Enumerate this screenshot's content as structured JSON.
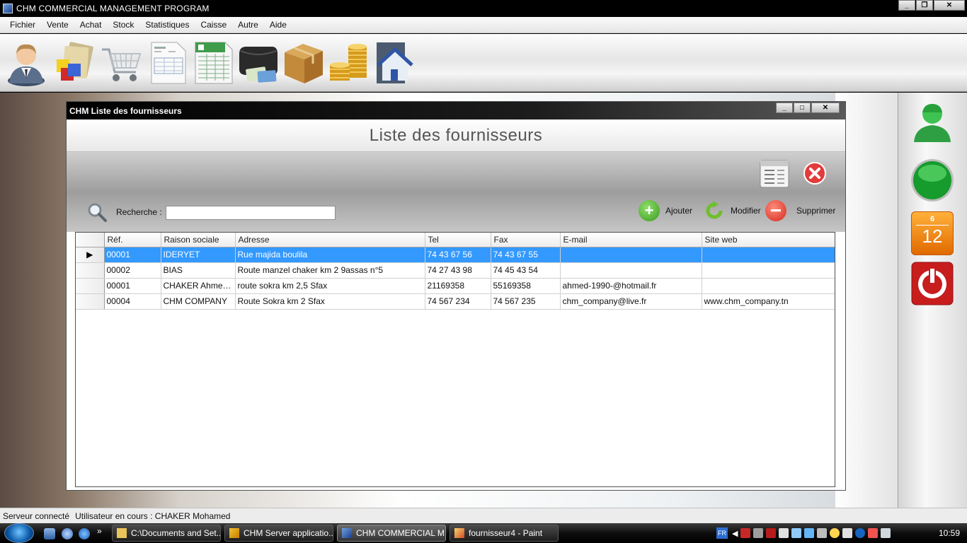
{
  "app": {
    "title": "CHM COMMERCIAL MANAGEMENT PROGRAM"
  },
  "menu": [
    "Fichier",
    "Vente",
    "Achat",
    "Stock",
    "Statistiques",
    "Caisse",
    "Autre",
    "Aide"
  ],
  "toolbar_icons": [
    "user-icon",
    "products-icon",
    "cart-icon",
    "invoice-icon",
    "spreadsheet-icon",
    "wallet-icon",
    "box-icon",
    "coins-icon",
    "home-icon"
  ],
  "side_panel": {
    "calendar_month": "6",
    "calendar_day": "12",
    "icons": [
      "online-user-icon",
      "status-globe-icon",
      "calendar-icon",
      "power-icon"
    ]
  },
  "child_window": {
    "title": "CHM Liste des fournisseurs",
    "heading": "Liste des fournisseurs",
    "search_label": "Recherche :",
    "search_value": "",
    "actions": {
      "add": "Ajouter",
      "modify": "Modifier",
      "delete": "Supprimer"
    }
  },
  "grid": {
    "columns": [
      "Réf.",
      "Raison sociale",
      "Adresse",
      "Tel",
      "Fax",
      "E-mail",
      "Site web"
    ],
    "rows": [
      {
        "ref": "00001",
        "raison": "IDERYET",
        "adresse": "Rue majida boulila",
        "tel": "74 43 67 56",
        "fax": "74 43 67 55",
        "email": "",
        "site": "",
        "selected": true
      },
      {
        "ref": "00002",
        "raison": "BIAS",
        "adresse": "Route manzel chaker km 2 9assas n°5",
        "tel": "74 27 43 98",
        "fax": "74 45 43 54",
        "email": "",
        "site": "",
        "selected": false
      },
      {
        "ref": "00001",
        "raison": "CHAKER Ahmed ...",
        "adresse": "route sokra km 2,5 Sfax",
        "tel": "21169358",
        "fax": "55169358",
        "email": "ahmed-1990-@hotmail.fr",
        "site": "",
        "selected": false
      },
      {
        "ref": "00004",
        "raison": "CHM COMPANY",
        "adresse": "Route Sokra km 2 Sfax",
        "tel": "74 567 234",
        "fax": "74 567 235",
        "email": "chm_company@live.fr",
        "site": "www.chm_company.tn",
        "selected": false
      }
    ]
  },
  "status": {
    "server": "Serveur connecté",
    "user": "Utilisateur en cours : CHAKER Mohamed"
  },
  "taskbar": {
    "tasks": [
      {
        "label": "C:\\Documents and Set...",
        "active": false
      },
      {
        "label": "CHM Server applicatio...",
        "active": false
      },
      {
        "label": "CHM COMMERCIAL M...",
        "active": true
      },
      {
        "label": "fournisseur4 - Paint",
        "active": false
      }
    ],
    "lang": "FR",
    "clock": "10:59",
    "quick_more": "»"
  }
}
